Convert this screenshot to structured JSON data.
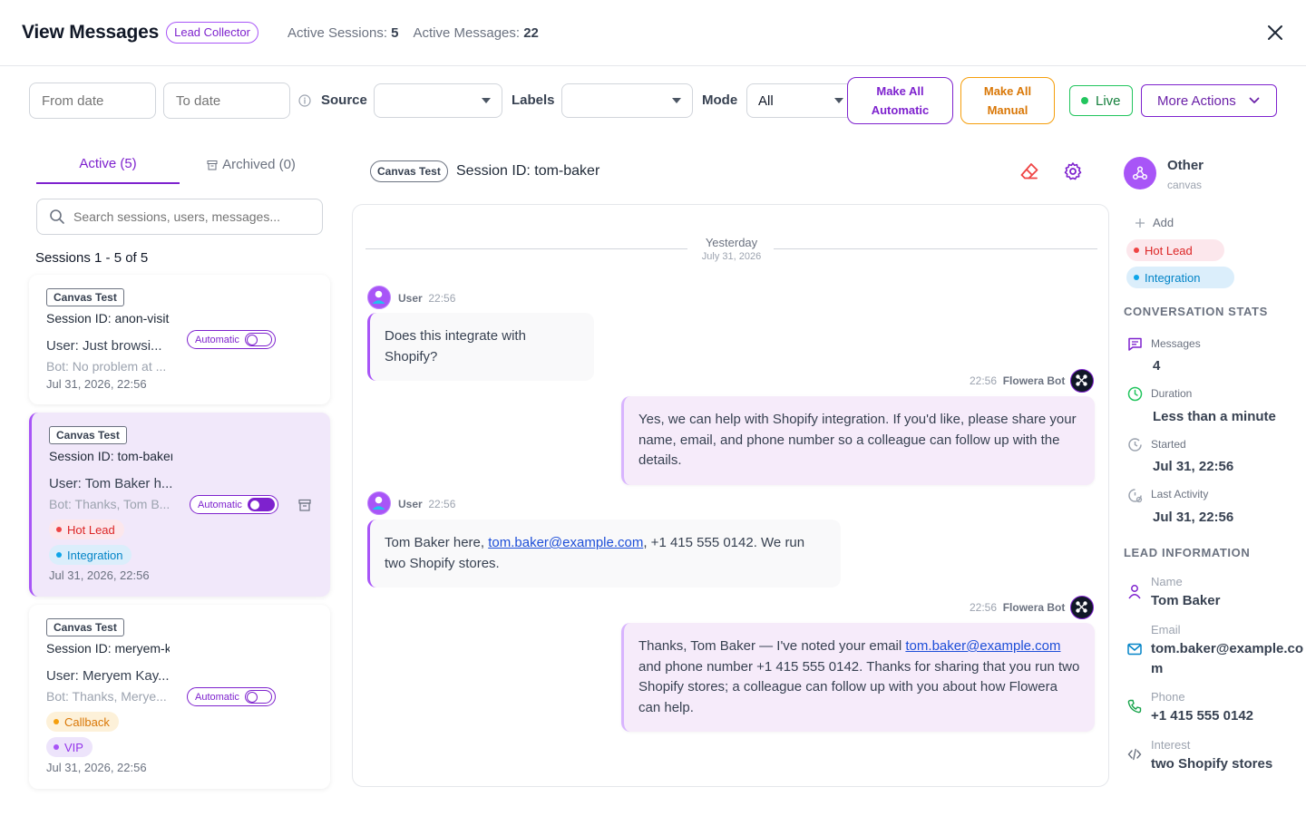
{
  "header": {
    "title": "View Messages",
    "badge": "Lead Collector",
    "active_sessions_label": "Active Sessions:",
    "active_sessions_value": "5",
    "active_messages_label": "Active Messages:",
    "active_messages_value": "22"
  },
  "toolbar": {
    "from_date_placeholder": "From date",
    "to_date_placeholder": "To date",
    "source_label": "Source",
    "source_value": "",
    "labels_label": "Labels",
    "labels_value": "",
    "mode_label": "Mode",
    "mode_value": "All",
    "make_all_automatic": "Make All Automatic",
    "make_all_manual": "Make All Manual",
    "live_label": "Live",
    "more_actions_label": "More Actions"
  },
  "sidebar": {
    "tab_active": "Active (5)",
    "tab_archived": "Archived (0)",
    "search_placeholder": "Search sessions, users, messages...",
    "sessions_count": "Sessions 1 - 5 of 5",
    "sessions": [
      {
        "tag": "Canvas Test",
        "session_id": "Session ID: anon-visit",
        "user": "User: Just browsi...",
        "bot": "Bot: No problem at ...",
        "mode": "Automatic",
        "date": "Jul 31, 2026, 22:56",
        "labels": []
      },
      {
        "tag": "Canvas Test",
        "session_id": "Session ID: tom-baker",
        "user": "User: Tom Baker h...",
        "bot": "Bot: Thanks, Tom B...",
        "mode": "Automatic",
        "date": "Jul 31, 2026, 22:56",
        "labels": [
          "Hot Lead",
          "Integration"
        ]
      },
      {
        "tag": "Canvas Test",
        "session_id": "Session ID: meryem-k",
        "user": "User: Meryem Kay...",
        "bot": "Bot: Thanks, Merye...",
        "mode": "Automatic",
        "date": "Jul 31, 2026, 22:56",
        "labels": [
          "Callback",
          "VIP"
        ]
      }
    ]
  },
  "chat": {
    "tag": "Canvas Test",
    "session_id": "Session ID: tom-baker",
    "date_main": "Yesterday",
    "date_sub": "July 31, 2026",
    "messages": [
      {
        "sender": "User",
        "time": "22:56",
        "text": "Does this integrate with Shopify?"
      },
      {
        "sender": "Flowera Bot",
        "time": "22:56",
        "text": "Yes, we can help with Shopify integration. If you'd like, please share your name, email, and phone number so a colleague can follow up with the details."
      },
      {
        "sender": "User",
        "time": "22:56",
        "text_before": "Tom Baker here, ",
        "link": "tom.baker@example.com",
        "text_after": ", +1 415 555 0142. We run two Shopify stores."
      },
      {
        "sender": "Flowera Bot",
        "time": "22:56",
        "text_before": "Thanks, Tom Baker — I've noted your email ",
        "link": "tom.baker@example.com",
        "text_after": " and phone number +1 415 555 0142. Thanks for sharing that you run two Shopify stores; a colleague can follow up with you about how Flowera can help."
      }
    ]
  },
  "details": {
    "source_name": "Other",
    "source_sub": "canvas",
    "add_label": "Add",
    "labels": [
      "Hot Lead",
      "Integration"
    ],
    "stats_title": "CONVERSATION STATS",
    "stats": [
      {
        "label": "Messages",
        "value": "4"
      },
      {
        "label": "Duration",
        "value": "Less than a minute"
      },
      {
        "label": "Started",
        "value": "Jul 31, 22:56"
      },
      {
        "label": "Last Activity",
        "value": "Jul 31, 22:56"
      }
    ],
    "lead_title": "LEAD INFORMATION",
    "lead": [
      {
        "label": "Name",
        "value": "Tom Baker"
      },
      {
        "label": "Email",
        "value": "tom.baker@example.com"
      },
      {
        "label": "Phone",
        "value": "+1 415 555 0142"
      },
      {
        "label": "Interest",
        "value": "two Shopify stores"
      }
    ]
  },
  "colors": {
    "accent": "#7e22ce",
    "live": "#22c55e",
    "manual": "#f59e0b",
    "hot_lead": "#ef4444",
    "integration": "#0ea5e9"
  }
}
